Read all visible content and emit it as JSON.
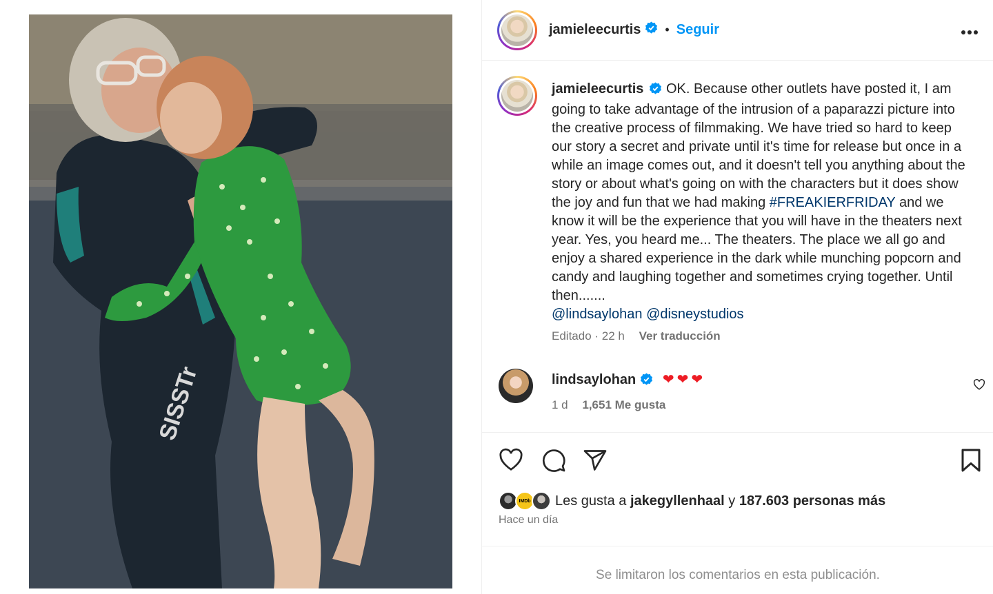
{
  "post": {
    "username": "jamieleecurtis",
    "follow_label": "Seguir",
    "dot": "•"
  },
  "caption": {
    "username": "jamieleecurtis",
    "text_part1": "OK. Because other outlets have posted it, I am going to take advantage of the intrusion of a paparazzi picture into the creative process of filmmaking. We have tried so hard to keep our story a secret and private until it's time for release but once in a while an image comes out, and it doesn't tell you anything about the story or about what's going on with the characters but it does show the joy and fun that we had making ",
    "hashtag": "#FREAKIERFRIDAY",
    "text_part2": " and we know it will be the experience that you will have in the theaters next year. Yes, you heard me... The theaters. The place we all go and enjoy a shared experience in the dark while munching popcorn and candy and laughing together and sometimes crying together. Until then.......",
    "mention1": "@lindsaylohan",
    "mention2": "@disneystudios",
    "edited": "Editado · 22 h",
    "translate": "Ver traducción"
  },
  "comment": {
    "username": "lindsaylohan",
    "hearts": "❤❤❤",
    "age": "1 d",
    "likes": "1,651 Me gusta"
  },
  "likes": {
    "prefix": "Les gusta a ",
    "user": "jakegyllenhaal",
    "middle": " y ",
    "count": "187.603 personas más",
    "badge": "IMDb"
  },
  "time_ago": "Hace un día",
  "comments_limited": "Se limitaron los comentarios en esta publicación.",
  "photo": {
    "wetsuit_logo": "SISSTr"
  },
  "colors": {
    "link": "#0095f6",
    "hashtag": "#00376b",
    "heart": "#ed1c24",
    "verified": "#0095f6"
  },
  "icons": [
    "verified-badge-icon",
    "more-options-icon",
    "heart-icon",
    "comment-icon",
    "share-icon",
    "bookmark-icon"
  ]
}
